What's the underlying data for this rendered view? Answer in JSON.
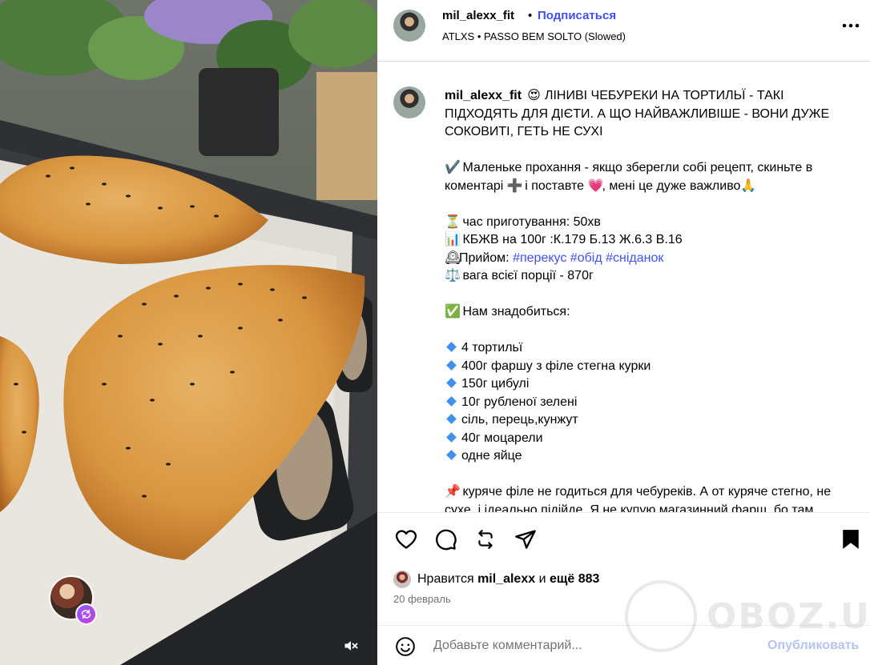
{
  "header": {
    "username": "mil_alexx_fit",
    "separator": "•",
    "follow_label": "Подписаться",
    "audio": "ATLXS • PASSO BEM SOLTO (Slowed)"
  },
  "caption": {
    "username": "mil_alexx_fit",
    "title_emoji": "😍",
    "title": "ЛІНИВІ ЧЕБУРЕКИ НА ТОРТИЛЬЇ - ТАКІ ПІДХОДЯТЬ ДЛЯ ДІЄТИ. А ЩО НАЙВАЖЛИВІШЕ - ВОНИ ДУЖЕ СОКОВИТІ, ГЕТЬ НЕ СУХІ",
    "request_emoji": "✔️",
    "request_a": "Маленьке прохання - якщо зберегли собі рецепт, скиньте в коментарі",
    "request_plus": "➕",
    "request_b": "і поставте",
    "request_heart": "💗",
    "request_c": ", мені це дуже важливо",
    "request_pray": "🙏",
    "time_emoji": "⏳",
    "time": "час приготування: 50хв",
    "kbju_emoji": "📊",
    "kbju": "КБЖВ на 100г :К.179 Б.13 Ж.6.3 В.16",
    "meal_emoji": "🕰",
    "meal_label": "Прийом:",
    "tags": [
      "#перекус",
      "#обід",
      "#сніданок"
    ],
    "weight_emoji": "⚖️",
    "weight": "вага всієї порції - 870г",
    "need_emoji": "✅",
    "need": "Нам знадобиться:",
    "ingredients": [
      "4 тортильї",
      "400г фаршу з філе стегна курки",
      "150г цибулі",
      "10г рубленої зелені",
      "сіль, перець,кунжут",
      "40г моцарели",
      "одне яйце"
    ],
    "note_emoji": "📌",
    "note": "куряче філе не годиться для чебуреків. А от куряче стегно, не сухе, і ідеально підійде. Я не купую магазинний фарш, бо там"
  },
  "likes": {
    "prefix": "Нравится",
    "user": "mil_alexx",
    "and": "и",
    "more": "ещё 883"
  },
  "date": "20 февраль",
  "comment": {
    "placeholder": "Добавьте комментарий...",
    "publish_label": "Опубликовать"
  },
  "watermark": "OBOZ.UA",
  "colors": {
    "link": "#4150f7",
    "publish_disabled": "#b3c4f7",
    "muted_text": "#737373",
    "divider": "#dbdbdb"
  }
}
